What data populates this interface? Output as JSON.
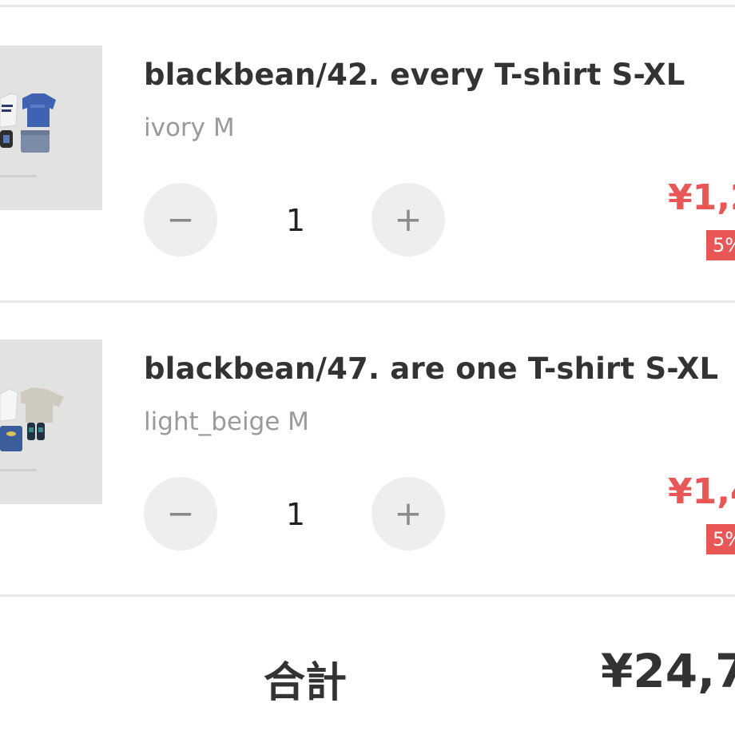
{
  "cart": {
    "items": [
      {
        "title": "blackbean/42. every T-shirt S-XL",
        "variant": "ivory M",
        "quantity": "1",
        "decrement_icon": "minus-icon",
        "increment_icon": "plus-icon",
        "price": "¥1,2",
        "discount_badge": "5%"
      },
      {
        "title": "blackbean/47. are one T-shirt S-XL",
        "variant": "light_beige M",
        "quantity": "1",
        "decrement_icon": "minus-icon",
        "increment_icon": "plus-icon",
        "price": "¥1,4",
        "discount_badge": "5%"
      }
    ],
    "total": {
      "label": "合計",
      "value": "¥24,7"
    }
  },
  "colors": {
    "price_red": "#e85656",
    "badge_red": "#e85656",
    "text_dark": "#333333",
    "text_muted": "#9a9a9a",
    "button_bg": "#eeeeee",
    "divider": "#e8e8e8"
  },
  "symbols": {
    "minus": "−",
    "plus": "+"
  }
}
